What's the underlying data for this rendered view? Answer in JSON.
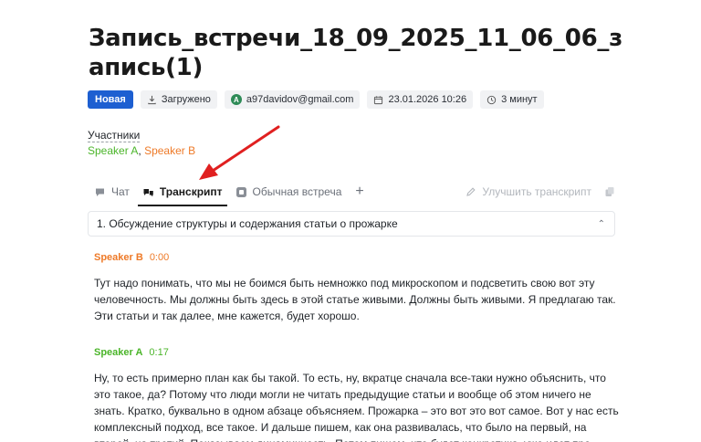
{
  "recording": {
    "title": "Запись_встречи_18_09_2025_11_06_06_запись(1)"
  },
  "meta": {
    "status": "Новая",
    "upload_label": "Загружено",
    "avatar_letter": "A",
    "email": "a97davidov@gmail.com",
    "datetime": "23.01.2026 10:26",
    "duration": "3 минут"
  },
  "participants": {
    "label": "Участники",
    "speakers": [
      "Speaker A",
      "Speaker B"
    ],
    "separator": ","
  },
  "tabs": {
    "chat": "Чат",
    "transcript": "Транскрипт",
    "meeting_type": "Обычная встреча",
    "add": "+",
    "improve": "Улучшить транскрипт"
  },
  "section": {
    "title": "1. Обсуждение структуры и содержания статьи о прожарке"
  },
  "segments": [
    {
      "speaker": "Speaker B",
      "time": "0:00",
      "text": "Тут надо понимать, что мы не боимся быть немножко под микроскопом и подсветить свою вот эту человечность. Мы должны быть здесь в этой статье живыми. Должны быть живыми. Я предлагаю так. Эти статьи и так далее, мне кажется, будет хорошо."
    },
    {
      "speaker": "Speaker A",
      "time": "0:17",
      "text": "Ну, то есть примерно план как бы такой. То есть, ну, вкратце сначала все-таки нужно объяснить, что это такое, да? Потому что люди могли не читать предыдущие статьи и вообще об этом ничего не знать. Кратко, буквально в одном абзаце объясняем. Прожарка – это вот это вот самое. Вот у нас есть комплексный подход, все такое. И дальше пишем, как она развивалась, что было на первый, на второй, на третий. Показываем динамичность. Потом пишем, что будет конкретика, уже идет про"
    }
  ],
  "colors": {
    "speaker_a": "#4bb52a",
    "speaker_b": "#ee7a28",
    "status_badge": "#1d5fd1",
    "annotation_arrow": "#e02020"
  },
  "icons": [
    "download-icon",
    "avatar",
    "calendar-icon",
    "clock-icon",
    "chat-icon",
    "transcript-icon",
    "meeting-icon",
    "plus-icon",
    "pencil-icon",
    "copy-icon",
    "chevron-up-icon"
  ]
}
